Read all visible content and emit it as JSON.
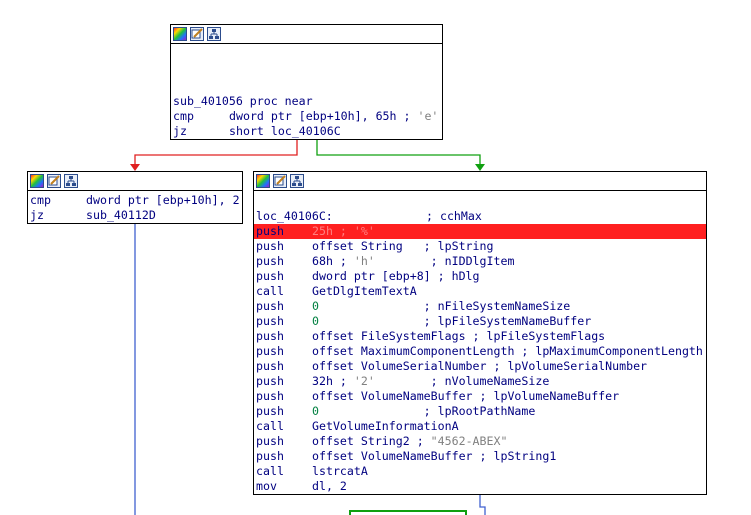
{
  "colors": {
    "instr": "#000080",
    "immediate": "#008040",
    "comment_gray": "#808080",
    "edge_false": "#e02020",
    "edge_true": "#10a010",
    "edge_other": "#4060d0",
    "highlight": "#ff2020"
  },
  "toolbar_icons": [
    "colors-icon",
    "edit-node-icon",
    "graph-icon"
  ],
  "block_top": {
    "lines": [
      {
        "m": "sub_401056 proc near",
        "o": "",
        "c": ""
      },
      {
        "m": "cmp",
        "o": "dword ptr [ebp+10h], 65h ;",
        "c": " 'e'"
      },
      {
        "m": "jz",
        "o": "short loc_40106C",
        "c": ""
      }
    ]
  },
  "block_left": {
    "lines": [
      {
        "m": "cmp",
        "o": "dword ptr [ebp+10h], 2",
        "c": ""
      },
      {
        "m": "jz",
        "o": "sub_40112D",
        "c": ""
      }
    ]
  },
  "block_main": {
    "label": "loc_40106C:",
    "label_comment": "; cchMax",
    "lines": [
      {
        "m": "push",
        "o": "25h ;",
        "c": " '%'",
        "hl": true
      },
      {
        "m": "push",
        "o": "offset String   ; lpString",
        "c": ""
      },
      {
        "m": "push",
        "o": "68h ;",
        "c": " 'h'",
        "tail": "        ; nIDDlgItem"
      },
      {
        "m": "push",
        "o": "dword ptr [ebp+8] ; hDlg",
        "c": ""
      },
      {
        "m": "call",
        "o": "GetDlgItemTextA",
        "c": ""
      },
      {
        "m": "push",
        "o": "0",
        "tail": "               ; nFileSystemNameSize",
        "imm": true
      },
      {
        "m": "push",
        "o": "0",
        "tail": "               ; lpFileSystemNameBuffer",
        "imm": true
      },
      {
        "m": "push",
        "o": "offset FileSystemFlags ; lpFileSystemFlags",
        "c": ""
      },
      {
        "m": "push",
        "o": "offset MaximumComponentLength ; lpMaximumComponentLength",
        "c": ""
      },
      {
        "m": "push",
        "o": "offset VolumeSerialNumber ; lpVolumeSerialNumber",
        "c": ""
      },
      {
        "m": "push",
        "o": "32h ;",
        "c": " '2'",
        "tail": "        ; nVolumeNameSize"
      },
      {
        "m": "push",
        "o": "offset VolumeNameBuffer ; lpVolumeNameBuffer",
        "c": ""
      },
      {
        "m": "push",
        "o": "0",
        "tail": "               ; lpRootPathName",
        "imm": true
      },
      {
        "m": "call",
        "o": "GetVolumeInformationA",
        "c": ""
      },
      {
        "m": "push",
        "o": "offset String2 ;",
        "c": " \"4562-ABEX\""
      },
      {
        "m": "push",
        "o": "offset VolumeNameBuffer ; lpString1",
        "c": ""
      },
      {
        "m": "call",
        "o": "lstrcatA",
        "c": ""
      },
      {
        "m": "mov",
        "o": "dl, 2",
        "c": ""
      }
    ]
  }
}
